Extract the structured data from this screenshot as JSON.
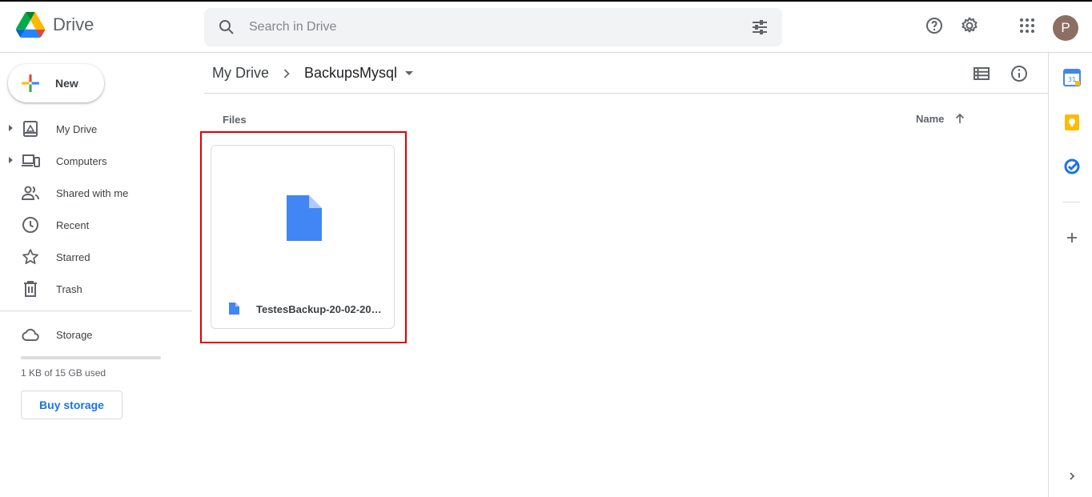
{
  "app": {
    "name": "Drive"
  },
  "search": {
    "placeholder": "Search in Drive"
  },
  "header": {
    "avatar_letter": "P"
  },
  "sidebar": {
    "new_label": "New",
    "items": [
      {
        "label": "My Drive",
        "icon": "my-drive-icon",
        "expandable": true
      },
      {
        "label": "Computers",
        "icon": "computers-icon",
        "expandable": true
      },
      {
        "label": "Shared with me",
        "icon": "shared-icon",
        "expandable": false
      },
      {
        "label": "Recent",
        "icon": "clock-icon",
        "expandable": false
      },
      {
        "label": "Starred",
        "icon": "star-icon",
        "expandable": false
      },
      {
        "label": "Trash",
        "icon": "trash-icon",
        "expandable": false
      }
    ],
    "storage": {
      "label": "Storage",
      "used_text": "1 KB of 15 GB used",
      "used_fraction": 0.0,
      "buy_label": "Buy storage"
    }
  },
  "main": {
    "breadcrumb": {
      "root": "My Drive",
      "current": "BackupsMysql"
    },
    "section_label": "Files",
    "sort_label": "Name",
    "files": [
      {
        "name": "TestesBackup-20-02-202…"
      }
    ]
  },
  "colors": {
    "accent_blue": "#1a73e8",
    "file_blue": "#4285f4",
    "highlight_red": "#e00000",
    "avatar_brown": "#8d6e63"
  }
}
